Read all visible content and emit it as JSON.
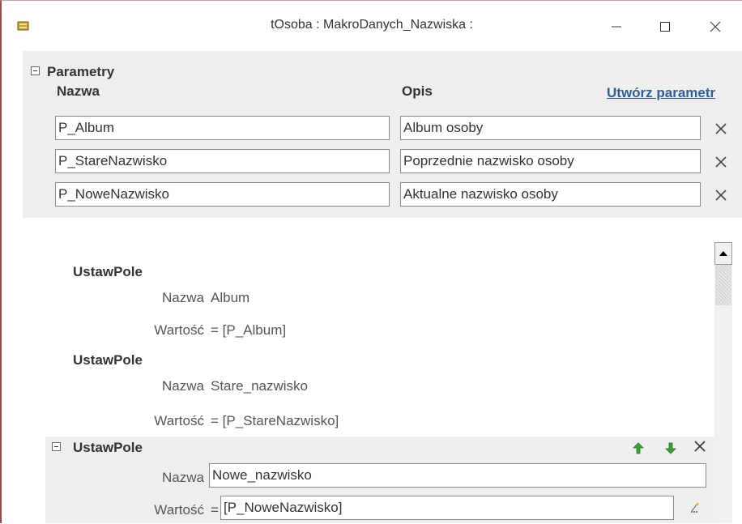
{
  "window": {
    "title": "tOsoba : MakroDanych_Nazwiska :",
    "app_icon": "macro-scroll-icon",
    "controls": [
      "minimize-icon",
      "maximize-icon",
      "close-icon"
    ]
  },
  "parameters": {
    "title": "Parametry",
    "col_name": "Nazwa",
    "col_desc": "Opis",
    "create_link": "Utwórz parametr",
    "rows": [
      {
        "name": "P_Album",
        "desc": "Album osoby"
      },
      {
        "name": "P_StareNazwisko",
        "desc": "Poprzednie nazwisko osoby"
      },
      {
        "name": "P_NoweNazwisko",
        "desc": "Aktualne nazwisko osoby"
      }
    ]
  },
  "actions": [
    {
      "title": "UstawPole",
      "name_label": "Nazwa",
      "name_value": "Album",
      "value_label": "Wartość",
      "value_value": "= [P_Album]"
    },
    {
      "title": "UstawPole",
      "name_label": "Nazwa",
      "name_value": "Stare_nazwisko",
      "value_label": "Wartość",
      "value_value": "= [P_StareNazwisko]"
    },
    {
      "title": "UstawPole",
      "name_label": "Nazwa",
      "name_value": "Nowe_nazwisko",
      "value_label": "Wartość",
      "value_eq": "=",
      "value_value": "[P_NoweNazwisko]"
    }
  ],
  "colors": {
    "link": "#2e5d9a",
    "panel_bg": "#eeeeee",
    "arrow_green": "#3aa33a"
  }
}
